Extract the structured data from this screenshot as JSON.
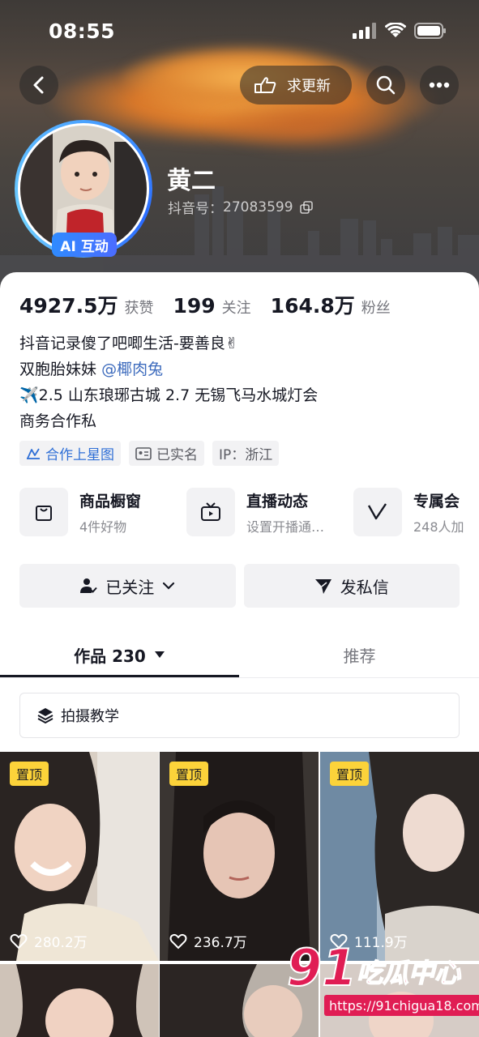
{
  "status_bar": {
    "time": "08:55"
  },
  "header": {
    "request_update_label": "求更新",
    "ai_badge": "AI 互动",
    "name": "黄二",
    "douyin_id_label": "抖音号：",
    "douyin_id": "27083599"
  },
  "stats": [
    {
      "value": "4927.5万",
      "label": "获赞"
    },
    {
      "value": "199",
      "label": "关注"
    },
    {
      "value": "164.8万",
      "label": "粉丝"
    }
  ],
  "bio": {
    "line1": "抖音记录傻了吧唧生活-要善良✌",
    "line2_prefix": "双胞胎妹妹",
    "line2_mention": "@椰肉兔",
    "line3": "✈️2.5 山东琅琊古城 2.7 无锡飞马水城灯会",
    "line4": "商务合作私"
  },
  "tags": {
    "cooperation": "合作上星图",
    "verified": "已实名",
    "ip": "IP：浙江"
  },
  "services": [
    {
      "title": "商品橱窗",
      "subtitle": "4件好物"
    },
    {
      "title": "直播动态",
      "subtitle": "设置开播通…"
    },
    {
      "title": "专属会",
      "subtitle": "248人加"
    }
  ],
  "actions": {
    "follow": "已关注",
    "message": "发私信"
  },
  "tabs": {
    "works": "作品 230",
    "recommend": "推荐"
  },
  "tutorial_label": "拍摄教学",
  "videos": [
    {
      "pinned": "置顶",
      "likes": "280.2万"
    },
    {
      "pinned": "置顶",
      "likes": "236.7万"
    },
    {
      "pinned": "置顶",
      "likes": "111.9万"
    }
  ],
  "watermark": {
    "logo": "91吃瓜中心",
    "url": "https://91chigua18.com"
  },
  "colors": {
    "accent_blue": "#2f6fd6",
    "pin_yellow": "#fcd33a",
    "watermark_red": "#e01d54"
  }
}
